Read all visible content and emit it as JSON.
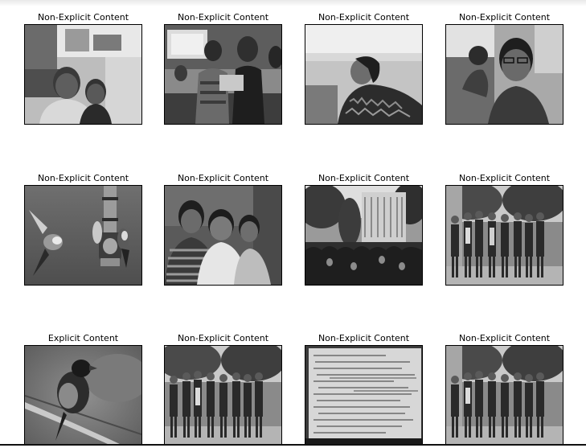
{
  "panels": [
    {
      "title": "Non-Explicit Content",
      "subject": "two-people-outdoors-selfie"
    },
    {
      "title": "Non-Explicit Content",
      "subject": "classroom-students"
    },
    {
      "title": "Non-Explicit Content",
      "subject": "woman-looking-sideways"
    },
    {
      "title": "Non-Explicit Content",
      "subject": "young-man-selfie-classroom"
    },
    {
      "title": "Non-Explicit Content",
      "subject": "birds-at-feeder"
    },
    {
      "title": "Non-Explicit Content",
      "subject": "three-people-selfie"
    },
    {
      "title": "Non-Explicit Content",
      "subject": "crowd-in-front-of-building"
    },
    {
      "title": "Non-Explicit Content",
      "subject": "group-standing-under-trees"
    },
    {
      "title": "Explicit Content",
      "subject": "bird-on-branch"
    },
    {
      "title": "Non-Explicit Content",
      "subject": "group-standing-under-trees"
    },
    {
      "title": "Non-Explicit Content",
      "subject": "handwritten-document-on-screen"
    },
    {
      "title": "Non-Explicit Content",
      "subject": "group-standing-under-trees"
    }
  ]
}
